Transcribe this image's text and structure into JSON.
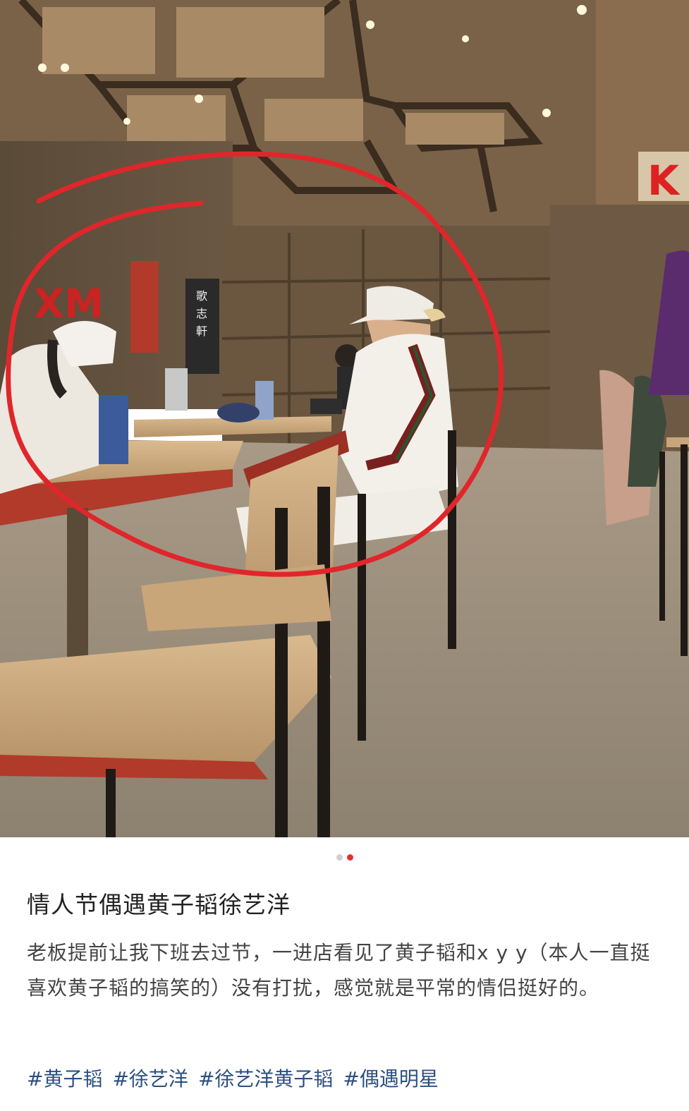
{
  "photo": {
    "wall_sign_chars": "歌志軒",
    "wall_poster_lines": [
      "歌",
      "志",
      "軒"
    ],
    "left_logo": "XM",
    "right_logo": "K"
  },
  "carousel": {
    "dot_count": 2,
    "active_index": 1
  },
  "post": {
    "title": "情人节偶遇黄子韬徐艺洋",
    "body": "老板提前让我下班去过节，一进店看见了黄子韬和x y y（本人一直挺喜欢黄子韬的搞笑的）没有打扰，感觉就是平常的情侣挺好的。",
    "tags": [
      "#黄子韬",
      "#徐艺洋",
      "#徐艺洋黄子韬",
      "#偶遇明星"
    ]
  },
  "colors": {
    "circle": "#e0262b",
    "tag": "#2b4f80",
    "active_dot": "#e03232"
  }
}
